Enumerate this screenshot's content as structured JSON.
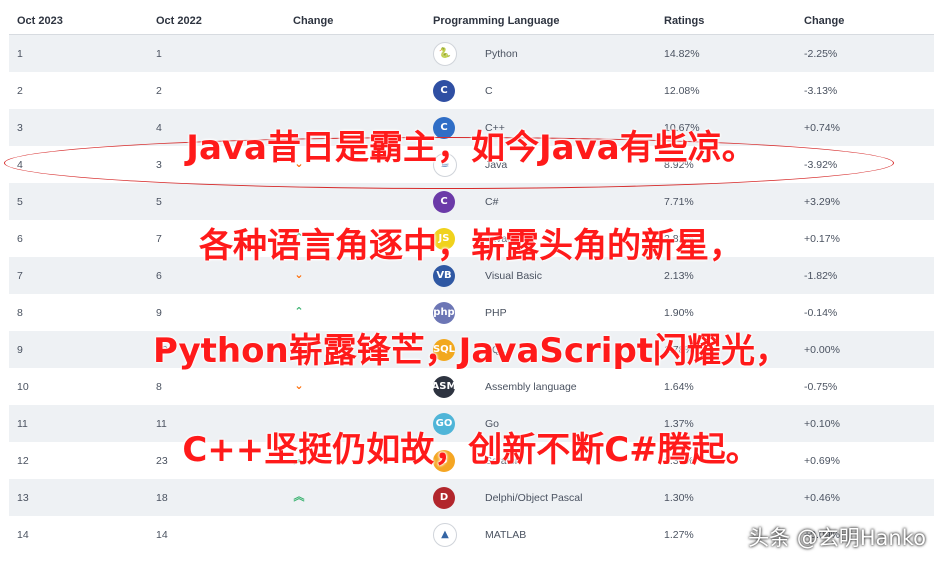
{
  "header": {
    "col_now": "Oct 2023",
    "col_prev": "Oct 2022",
    "col_change": "Change",
    "col_language": "Programming Language",
    "col_ratings": "Ratings",
    "col_delta": "Change"
  },
  "colors": {
    "up": "#3cb371",
    "down": "#ff6a00",
    "overlay_text": "#ff1a1a",
    "ellipse": "#d62b2b"
  },
  "rows": [
    {
      "now": "1",
      "prev": "1",
      "trend": "",
      "icon": "python-icon",
      "icon_text": "🐍",
      "icon_bg": "#ffffff",
      "lang": "Python",
      "rating": "14.82%",
      "delta": "-2.25%"
    },
    {
      "now": "2",
      "prev": "2",
      "trend": "",
      "icon": "c-icon",
      "icon_text": "C",
      "icon_bg": "#2f4fa3",
      "lang": "C",
      "rating": "12.08%",
      "delta": "-3.13%"
    },
    {
      "now": "3",
      "prev": "4",
      "trend": "",
      "icon": "cpp-icon",
      "icon_text": "C",
      "icon_bg": "#2f6ec6",
      "lang": "C++",
      "rating": "10.67%",
      "delta": "+0.74%"
    },
    {
      "now": "4",
      "prev": "3",
      "trend": "down",
      "icon": "java-icon",
      "icon_text": "☕",
      "icon_bg": "#ffffff",
      "lang": "Java",
      "rating": "8.92%",
      "delta": "-3.92%"
    },
    {
      "now": "5",
      "prev": "5",
      "trend": "",
      "icon": "csharp-icon",
      "icon_text": "C",
      "icon_bg": "#6b3aa8",
      "lang": "C#",
      "rating": "7.71%",
      "delta": "+3.29%"
    },
    {
      "now": "6",
      "prev": "7",
      "trend": "up",
      "icon": "javascript-icon",
      "icon_text": "JS",
      "icon_bg": "#f0d21c",
      "lang": "JavaScript",
      "rating": "2.82%",
      "delta": "+0.17%"
    },
    {
      "now": "7",
      "prev": "6",
      "trend": "down",
      "icon": "visual-basic-icon",
      "icon_text": "VB",
      "icon_bg": "#2f58a3",
      "lang": "Visual Basic",
      "rating": "2.13%",
      "delta": "-1.82%"
    },
    {
      "now": "8",
      "prev": "9",
      "trend": "up",
      "icon": "php-icon",
      "icon_text": "php",
      "icon_bg": "#6c76b5",
      "lang": "PHP",
      "rating": "1.90%",
      "delta": "-0.14%"
    },
    {
      "now": "9",
      "prev": "10",
      "trend": "up",
      "icon": "sql-icon",
      "icon_text": "SQL",
      "icon_bg": "#f2a81d",
      "lang": "SQL",
      "rating": "1.78%",
      "delta": "+0.00%"
    },
    {
      "now": "10",
      "prev": "8",
      "trend": "down",
      "icon": "assembly-icon",
      "icon_text": "ASM",
      "icon_bg": "#2d3340",
      "lang": "Assembly language",
      "rating": "1.64%",
      "delta": "-0.75%"
    },
    {
      "now": "11",
      "prev": "11",
      "trend": "",
      "icon": "go-icon",
      "icon_text": "GO",
      "icon_bg": "#4fb5d8",
      "lang": "Go",
      "rating": "1.37%",
      "delta": "+0.10%"
    },
    {
      "now": "12",
      "prev": "23",
      "trend": "up2",
      "icon": "scratch-icon",
      "icon_text": "S",
      "icon_bg": "#f5a623",
      "lang": "Scratch",
      "rating": "1.37%",
      "delta": "+0.69%"
    },
    {
      "now": "13",
      "prev": "18",
      "trend": "up2",
      "icon": "delphi-icon",
      "icon_text": "D",
      "icon_bg": "#b2262c",
      "lang": "Delphi/Object Pascal",
      "rating": "1.30%",
      "delta": "+0.46%"
    },
    {
      "now": "14",
      "prev": "14",
      "trend": "",
      "icon": "matlab-icon",
      "icon_text": "▲",
      "icon_bg": "#ffffff",
      "lang": "MATLAB",
      "rating": "1.27%",
      "delta": "+0.09%"
    }
  ],
  "overlay": {
    "line1": "Java昔日是霸主，如今Java有些凉。",
    "line2": "各种语言角逐中，崭露头角的新星，",
    "line3": "Python崭露锋芒，JavaScript闪耀光，",
    "line4": "C++坚挺仍如故，创新不断C#腾起。"
  },
  "watermark": "头条 @玄明Hanko"
}
